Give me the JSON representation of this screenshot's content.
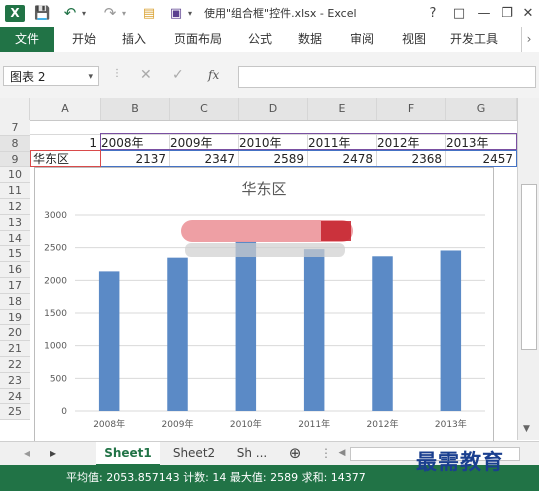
{
  "titlebar": {
    "app_icon": "X",
    "title": "使用\"组合框\"控件.xlsx - Excel",
    "help": "?"
  },
  "ribbon": {
    "file": "文件",
    "tabs": [
      "开始",
      "插入",
      "页面布局",
      "公式",
      "数据",
      "审阅",
      "视图",
      "开发工具"
    ]
  },
  "formula": {
    "namebox": "图表 2",
    "fx": "fx"
  },
  "grid": {
    "columns": [
      "A",
      "B",
      "C",
      "D",
      "E",
      "F",
      "G"
    ],
    "rows": [
      "7",
      "8",
      "9",
      "10",
      "11",
      "12",
      "13",
      "14",
      "15",
      "16",
      "17",
      "18",
      "19",
      "20",
      "21",
      "22",
      "23",
      "24",
      "25"
    ],
    "row8": [
      "1",
      "2008年",
      "2009年",
      "2010年",
      "2011年",
      "2012年",
      "2013年"
    ],
    "row9": [
      "华东区",
      "2137",
      "2347",
      "2589",
      "2478",
      "2368",
      "2457"
    ]
  },
  "chart_data": {
    "type": "bar",
    "title": "华东区",
    "categories": [
      "2008年",
      "2009年",
      "2010年",
      "2011年",
      "2012年",
      "2013年"
    ],
    "values": [
      2137,
      2347,
      2589,
      2478,
      2368,
      2457
    ],
    "ylim": [
      0,
      3000
    ],
    "yticks": [
      "0",
      "500",
      "1000",
      "1500",
      "2000",
      "2500",
      "3000"
    ],
    "grid": true,
    "bar_color": "#5b8ac6"
  },
  "sheets": {
    "tabs": [
      "Sheet1",
      "Sheet2",
      "Sh ..."
    ],
    "active": "Sheet1",
    "add": "⊕"
  },
  "status": {
    "text": "平均值: 2053.857143    计数: 14    最大值: 2589    求和: 14377"
  },
  "watermark": "最需教育",
  "colors": {
    "excel_green": "#217346",
    "purple_highlight": "#7a4fa1"
  }
}
